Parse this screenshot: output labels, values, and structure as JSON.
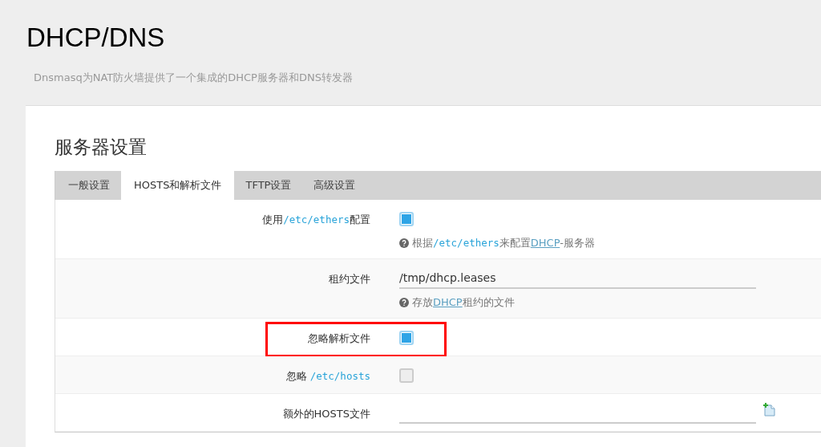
{
  "page": {
    "title": "DHCP/DNS",
    "description": "Dnsmasq为NAT防火墙提供了一个集成的DHCP服务器和DNS转发器"
  },
  "section": {
    "title": "服务器设置"
  },
  "tabs": [
    {
      "label": "一般设置",
      "selected": false
    },
    {
      "label": "HOSTS和解析文件",
      "selected": true
    },
    {
      "label": "TFTP设置",
      "selected": false
    },
    {
      "label": "高级设置",
      "selected": false
    }
  ],
  "rows": [
    {
      "kind": "checkbox",
      "label": [
        {
          "kind": "text",
          "text": "使用"
        },
        {
          "kind": "code",
          "text": "/etc/ethers"
        },
        {
          "kind": "text",
          "text": "配置"
        }
      ],
      "checked": true,
      "highlighted": false,
      "help": [
        {
          "kind": "text",
          "text": "根据"
        },
        {
          "kind": "code",
          "text": "/etc/ethers"
        },
        {
          "kind": "text",
          "text": "来配置"
        },
        {
          "kind": "link",
          "text": "DHCP"
        },
        {
          "kind": "text",
          "text": "-服务器"
        }
      ]
    },
    {
      "kind": "text",
      "label": [
        {
          "kind": "text",
          "text": "租约文件"
        }
      ],
      "value": "/tmp/dhcp.leases",
      "highlighted": false,
      "help": [
        {
          "kind": "text",
          "text": "存放"
        },
        {
          "kind": "link",
          "text": "DHCP"
        },
        {
          "kind": "text",
          "text": "租约的文件"
        }
      ]
    },
    {
      "kind": "checkbox",
      "label": [
        {
          "kind": "text",
          "text": "忽略解析文件"
        }
      ],
      "checked": true,
      "highlighted": true
    },
    {
      "kind": "checkbox",
      "label": [
        {
          "kind": "text",
          "text": "忽略 "
        },
        {
          "kind": "code",
          "text": "/etc/hosts"
        }
      ],
      "checked": false,
      "highlighted": false
    },
    {
      "kind": "list",
      "label": [
        {
          "kind": "text",
          "text": "额外的HOSTS文件"
        }
      ],
      "value": "",
      "highlighted": false
    }
  ]
}
